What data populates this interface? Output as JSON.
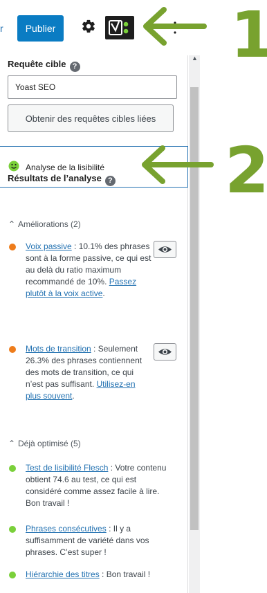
{
  "topbar": {
    "prev_link": "r",
    "publish_label": "Publier",
    "icons": [
      "gear-icon",
      "yoast-logo-icon",
      "more-options-icon"
    ]
  },
  "focus_keyphrase": {
    "label": "Requête cible",
    "value": "Yoast SEO",
    "related_button": "Obtenir des requêtes cibles liées"
  },
  "readability": {
    "label": "Analyse de la lisibilité",
    "status_color": "#7ad03a"
  },
  "results": {
    "heading": "Résultats de l’analyse",
    "improvements": {
      "header": "Améliorations (2)",
      "items": [
        {
          "link": "Voix passive",
          "text": " : 10.1% des phrases sont à la forme passive, ce qui est au delà du ratio maximum recommandé de 10%. ",
          "link2": "Passez plutôt à la voix active",
          "tail": ".",
          "color": "#ee7c1b"
        },
        {
          "link": "Mots de transition",
          "text": " : Seulement 26.3% des phrases contiennent des mots de transition, ce qui n’est pas suffisant. ",
          "link2": "Utilisez-en plus souvent",
          "tail": ".",
          "color": "#ee7c1b"
        }
      ]
    },
    "good": {
      "header": "Déjà optimisé (5)",
      "items": [
        {
          "link": "Test de lisibilité Flesch",
          "text": " : Votre contenu obtient 74.6 au test, ce qui est considéré comme assez facile à lire. Bon travail !",
          "color": "#7ad03a"
        },
        {
          "link": "Phrases consécutives",
          "text": " : Il y a suffisamment de variété dans vos phrases. C’est super !",
          "color": "#7ad03a"
        },
        {
          "link": "Hiérarchie des titres",
          "text": " : Bon travail !",
          "color": "#7ad03a"
        }
      ]
    }
  },
  "annotations": {
    "number_1": "1",
    "number_2": "2",
    "color": "#78a22f"
  }
}
